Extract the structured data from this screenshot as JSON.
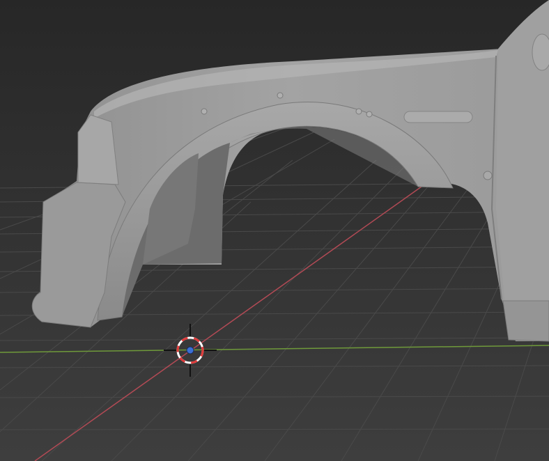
{
  "viewport": {
    "background_top": "#292929",
    "background_bottom": "#3d3d3d",
    "grid_color": "#4b4b4b",
    "x_axis_color": "#b24a55",
    "y_axis_color": "#6f9a3a",
    "model_color": "#9c9c9c"
  },
  "cursor": {
    "icon": "3d-cursor-icon",
    "ring_red": "#e03a3a",
    "ring_white": "#ffffff",
    "center": "#3b6fd6"
  }
}
